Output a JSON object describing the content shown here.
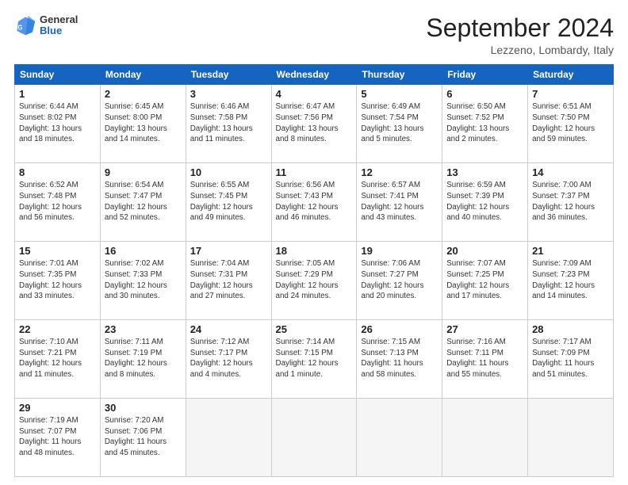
{
  "logo": {
    "general": "General",
    "blue": "Blue"
  },
  "title": "September 2024",
  "location": "Lezzeno, Lombardy, Italy",
  "days_header": [
    "Sunday",
    "Monday",
    "Tuesday",
    "Wednesday",
    "Thursday",
    "Friday",
    "Saturday"
  ],
  "weeks": [
    [
      {
        "day": "1",
        "info": "Sunrise: 6:44 AM\nSunset: 8:02 PM\nDaylight: 13 hours\nand 18 minutes."
      },
      {
        "day": "2",
        "info": "Sunrise: 6:45 AM\nSunset: 8:00 PM\nDaylight: 13 hours\nand 14 minutes."
      },
      {
        "day": "3",
        "info": "Sunrise: 6:46 AM\nSunset: 7:58 PM\nDaylight: 13 hours\nand 11 minutes."
      },
      {
        "day": "4",
        "info": "Sunrise: 6:47 AM\nSunset: 7:56 PM\nDaylight: 13 hours\nand 8 minutes."
      },
      {
        "day": "5",
        "info": "Sunrise: 6:49 AM\nSunset: 7:54 PM\nDaylight: 13 hours\nand 5 minutes."
      },
      {
        "day": "6",
        "info": "Sunrise: 6:50 AM\nSunset: 7:52 PM\nDaylight: 13 hours\nand 2 minutes."
      },
      {
        "day": "7",
        "info": "Sunrise: 6:51 AM\nSunset: 7:50 PM\nDaylight: 12 hours\nand 59 minutes."
      }
    ],
    [
      {
        "day": "8",
        "info": "Sunrise: 6:52 AM\nSunset: 7:48 PM\nDaylight: 12 hours\nand 56 minutes."
      },
      {
        "day": "9",
        "info": "Sunrise: 6:54 AM\nSunset: 7:47 PM\nDaylight: 12 hours\nand 52 minutes."
      },
      {
        "day": "10",
        "info": "Sunrise: 6:55 AM\nSunset: 7:45 PM\nDaylight: 12 hours\nand 49 minutes."
      },
      {
        "day": "11",
        "info": "Sunrise: 6:56 AM\nSunset: 7:43 PM\nDaylight: 12 hours\nand 46 minutes."
      },
      {
        "day": "12",
        "info": "Sunrise: 6:57 AM\nSunset: 7:41 PM\nDaylight: 12 hours\nand 43 minutes."
      },
      {
        "day": "13",
        "info": "Sunrise: 6:59 AM\nSunset: 7:39 PM\nDaylight: 12 hours\nand 40 minutes."
      },
      {
        "day": "14",
        "info": "Sunrise: 7:00 AM\nSunset: 7:37 PM\nDaylight: 12 hours\nand 36 minutes."
      }
    ],
    [
      {
        "day": "15",
        "info": "Sunrise: 7:01 AM\nSunset: 7:35 PM\nDaylight: 12 hours\nand 33 minutes."
      },
      {
        "day": "16",
        "info": "Sunrise: 7:02 AM\nSunset: 7:33 PM\nDaylight: 12 hours\nand 30 minutes."
      },
      {
        "day": "17",
        "info": "Sunrise: 7:04 AM\nSunset: 7:31 PM\nDaylight: 12 hours\nand 27 minutes."
      },
      {
        "day": "18",
        "info": "Sunrise: 7:05 AM\nSunset: 7:29 PM\nDaylight: 12 hours\nand 24 minutes."
      },
      {
        "day": "19",
        "info": "Sunrise: 7:06 AM\nSunset: 7:27 PM\nDaylight: 12 hours\nand 20 minutes."
      },
      {
        "day": "20",
        "info": "Sunrise: 7:07 AM\nSunset: 7:25 PM\nDaylight: 12 hours\nand 17 minutes."
      },
      {
        "day": "21",
        "info": "Sunrise: 7:09 AM\nSunset: 7:23 PM\nDaylight: 12 hours\nand 14 minutes."
      }
    ],
    [
      {
        "day": "22",
        "info": "Sunrise: 7:10 AM\nSunset: 7:21 PM\nDaylight: 12 hours\nand 11 minutes."
      },
      {
        "day": "23",
        "info": "Sunrise: 7:11 AM\nSunset: 7:19 PM\nDaylight: 12 hours\nand 8 minutes."
      },
      {
        "day": "24",
        "info": "Sunrise: 7:12 AM\nSunset: 7:17 PM\nDaylight: 12 hours\nand 4 minutes."
      },
      {
        "day": "25",
        "info": "Sunrise: 7:14 AM\nSunset: 7:15 PM\nDaylight: 12 hours\nand 1 minute."
      },
      {
        "day": "26",
        "info": "Sunrise: 7:15 AM\nSunset: 7:13 PM\nDaylight: 11 hours\nand 58 minutes."
      },
      {
        "day": "27",
        "info": "Sunrise: 7:16 AM\nSunset: 7:11 PM\nDaylight: 11 hours\nand 55 minutes."
      },
      {
        "day": "28",
        "info": "Sunrise: 7:17 AM\nSunset: 7:09 PM\nDaylight: 11 hours\nand 51 minutes."
      }
    ],
    [
      {
        "day": "29",
        "info": "Sunrise: 7:19 AM\nSunset: 7:07 PM\nDaylight: 11 hours\nand 48 minutes."
      },
      {
        "day": "30",
        "info": "Sunrise: 7:20 AM\nSunset: 7:06 PM\nDaylight: 11 hours\nand 45 minutes."
      },
      {
        "day": "",
        "info": ""
      },
      {
        "day": "",
        "info": ""
      },
      {
        "day": "",
        "info": ""
      },
      {
        "day": "",
        "info": ""
      },
      {
        "day": "",
        "info": ""
      }
    ]
  ]
}
